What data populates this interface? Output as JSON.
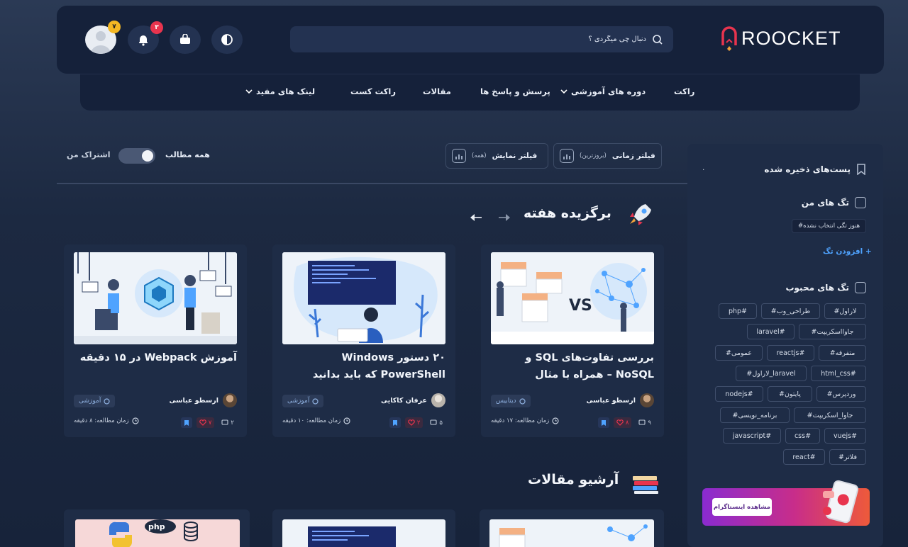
{
  "header": {
    "logo_text": "ROOCKET",
    "search_placeholder": "دنبال چی میگردی ؟",
    "notifications_count": "۳",
    "profile_badge": "۷"
  },
  "nav": {
    "items": [
      "راکت",
      "دوره های آموزشی",
      "پرسش و پاسخ ها",
      "مقالات",
      "راکت کست",
      "لینک های مفید"
    ]
  },
  "filters": {
    "time_label": "فیلتر زمانی",
    "time_value": "(بروزترین)",
    "display_label": "فیلتر نمایش",
    "display_value": "(همه)",
    "all_posts": "همه مطالب",
    "my_subscription": "اشتراک من"
  },
  "featured": {
    "title": "برگزیده هفته",
    "cards": [
      {
        "title": "بررسی تفاوت‌های SQL و NoSQL – همراه با مثال",
        "author": "ارسطو عباسی",
        "category": "دیتابیس",
        "read_time": "زمان مطالعه: ۱۷ دقیقه",
        "comments": "۹",
        "likes": "۸"
      },
      {
        "title": "۲۰ دستور Windows PowerShell که باید بدانید",
        "author": "عرفان کاکایی",
        "category": "آموزشی",
        "read_time": "زمان مطالعه: ۱۰ دقیقه",
        "comments": "۵",
        "likes": "۲"
      },
      {
        "title": "آموزش Webpack در ۱۵ دقیقه",
        "author": "ارسطو عباسی",
        "category": "آموزشی",
        "read_time": "زمان مطالعه: ۸ دقیقه",
        "comments": "۲",
        "likes": "۷"
      }
    ]
  },
  "archive": {
    "title": "آرشیو مقالات"
  },
  "sidebar": {
    "saved_title": "پست‌های ذخیره شده",
    "saved_count": "۰",
    "my_tags_title": "تگ های من",
    "no_tag": "#هنوز تگی انتخاب نشده",
    "add_tag": "+ افزودن تگ",
    "popular_title": "تگ های محبوب",
    "tags": [
      "#لاراول",
      "#طراحی_وب",
      "php#",
      "#جاوااسکریپت",
      "laravel#",
      "#متفرقه",
      "reactjs#",
      "#عمومی",
      "html_css#",
      "#لاراول_laravel",
      "#وردپرس",
      "#پایتون",
      "nodejs#",
      "#جاوا_اسکریپت",
      "#برنامه_نویسی",
      "vuejs#",
      "css#",
      "javascript#",
      "#فلاتر",
      "react#"
    ],
    "instagram_button": "مشاهده اینستاگرام"
  },
  "colors": {
    "background": "#1c2941",
    "panel": "#15213a",
    "card": "#1e2c46",
    "brand_red": "#e8344e",
    "accent_blue": "#4fa3ff"
  }
}
